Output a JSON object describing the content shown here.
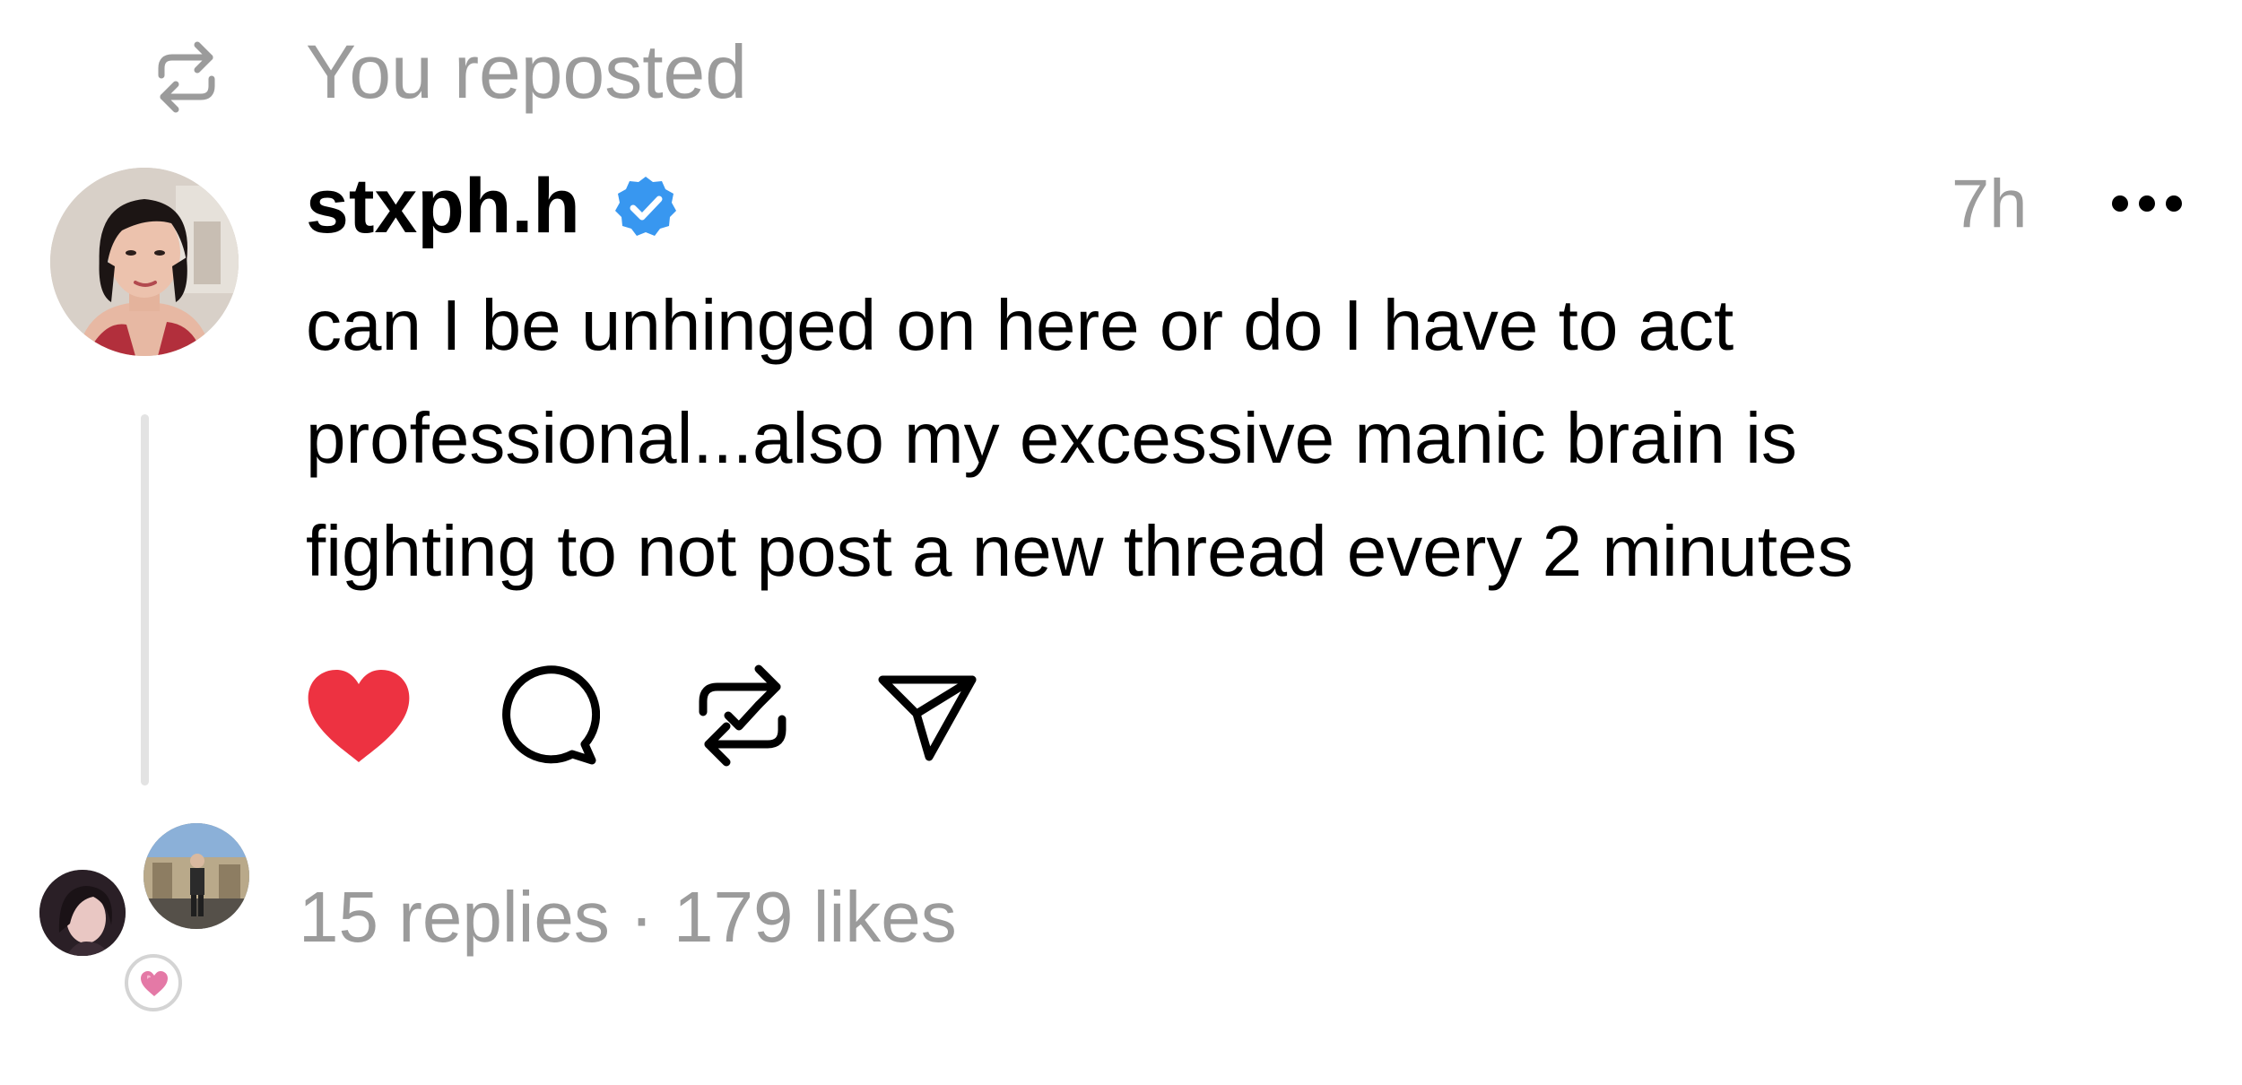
{
  "repost_header": {
    "icon": "repost-icon",
    "text": "You reposted"
  },
  "post": {
    "author": {
      "username": "stxph.h",
      "verified": true,
      "verified_color": "#3897f0"
    },
    "timestamp": "7h",
    "body_lines": [
      "can I be unhinged on here or do I have to act",
      "professional...also my excessive manic brain is",
      "fighting to not post a new thread every 2 minutes"
    ],
    "liked": true,
    "like_color": "#ed3241",
    "actions": [
      "heart-icon",
      "comment-icon",
      "repost-check-icon",
      "send-icon"
    ]
  },
  "footer": {
    "replies": "15 replies",
    "separator": "·",
    "likes": "179 likes",
    "reaction_icon": "pink-heart-icon"
  },
  "colors": {
    "text": "#000000",
    "muted": "#9b9b9b",
    "thread_line": "#e3e3e3"
  }
}
